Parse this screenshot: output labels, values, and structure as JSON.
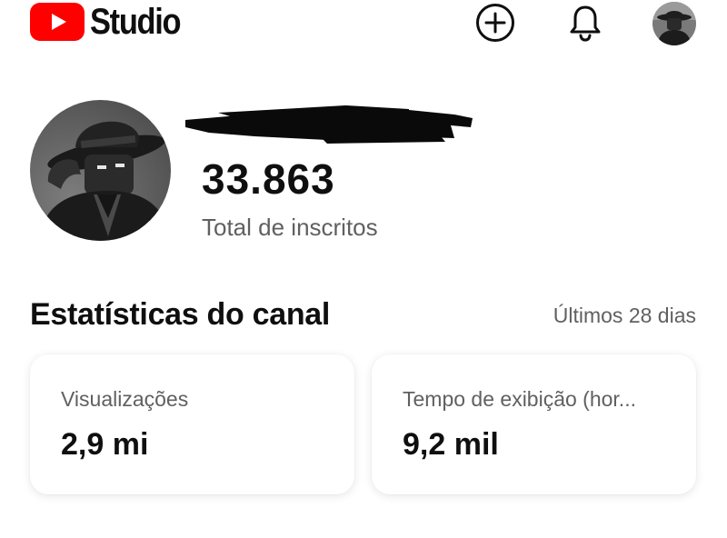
{
  "header": {
    "logo_text": "Studio",
    "brand_color": "#ff0000",
    "icons": [
      "youtube-play-icon",
      "create-plus-icon",
      "bell-icon",
      "avatar"
    ]
  },
  "channel": {
    "subscriber_count": "33.863",
    "subscriber_label": "Total de inscritos"
  },
  "stats": {
    "title": "Estatísticas do canal",
    "period": "Últimos 28 dias",
    "cards": [
      {
        "label": "Visualizações",
        "value": "2,9 mi"
      },
      {
        "label": "Tempo de exibição (hor...",
        "value": "9,2 mil"
      }
    ]
  }
}
